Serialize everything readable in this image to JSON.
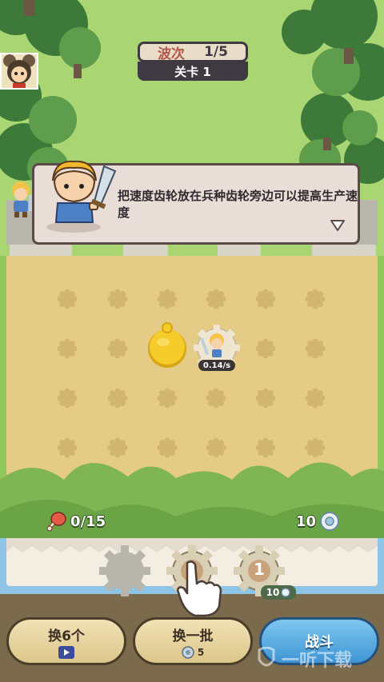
{
  "header": {
    "wave_label": "波次",
    "wave_value": "1/5",
    "level_label": "关卡 1"
  },
  "dialog": {
    "text": "把速度齿轮放在兵种齿轮旁边可以提高生产速度"
  },
  "board": {
    "unit_rate": "0.14/s"
  },
  "resources": {
    "food": "0/15",
    "gears": "10"
  },
  "tray": {
    "slots": [
      {
        "kind": "empty"
      },
      {
        "kind": "gear",
        "level": "1"
      },
      {
        "kind": "gear",
        "level": "1",
        "cost": "10"
      }
    ]
  },
  "buttons": {
    "swap6": "换6个",
    "swap_batch": "换一批",
    "swap_batch_cost": "5",
    "fight": "战斗"
  },
  "watermark": "一听下载",
  "colors": {
    "grass": "#b3dc7c",
    "field": "#e4cc86",
    "accent_blue": "#3f94d3",
    "tray": "#f3ede2"
  }
}
